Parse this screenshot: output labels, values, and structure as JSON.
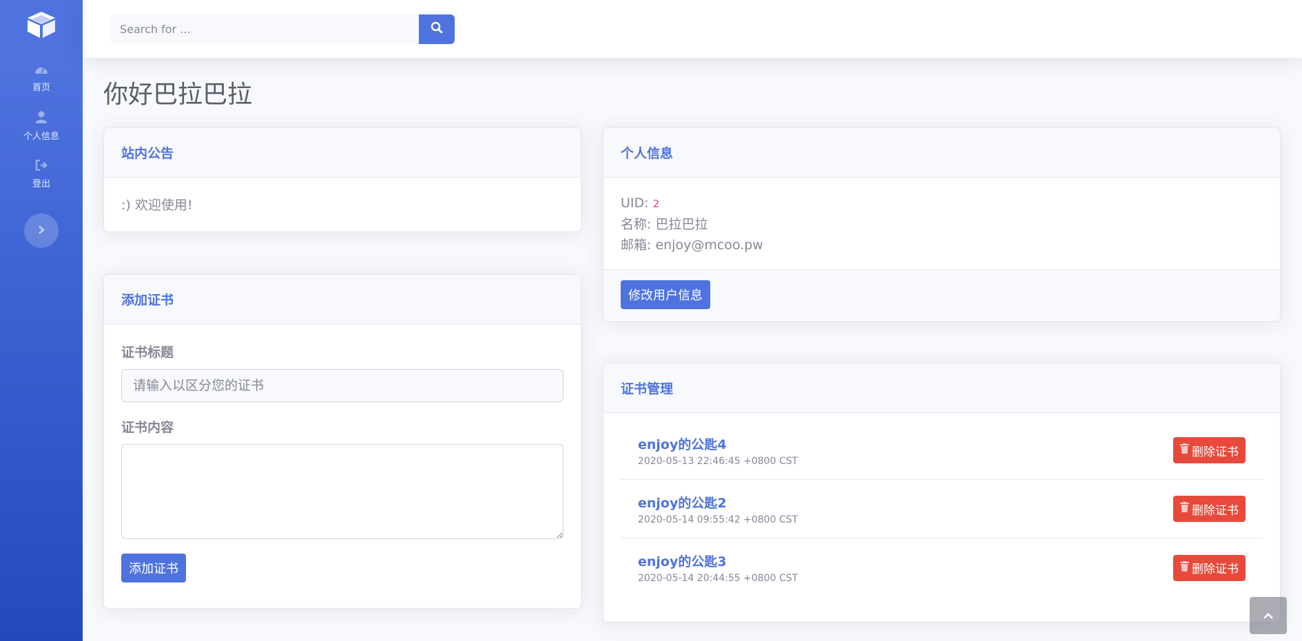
{
  "sidebar": {
    "logo_icon": "cube-icon",
    "items": [
      {
        "label": "首页",
        "icon": "dashboard-icon"
      },
      {
        "label": "个人信息",
        "icon": "user-icon"
      },
      {
        "label": "登出",
        "icon": "sign-out-icon"
      }
    ],
    "toggle_icon": "chevron-right-icon"
  },
  "topbar": {
    "search_placeholder": "Search for ...",
    "search_icon": "search-icon"
  },
  "page": {
    "title": "你好巴拉巴拉"
  },
  "announcement": {
    "title": "站内公告",
    "text": ":) 欢迎使用!"
  },
  "profile": {
    "title": "个人信息",
    "uid_label": "UID:",
    "uid_value": "2",
    "name_label": "名称:",
    "name_value": "巴拉巴拉",
    "email_label": "邮箱:",
    "email_value": "enjoy@mcoo.pw",
    "edit_button": "修改用户信息"
  },
  "add_cert": {
    "title": "添加证书",
    "cert_title_label": "证书标题",
    "cert_title_placeholder": "请输入以区分您的证书",
    "cert_content_label": "证书内容",
    "submit_button": "添加证书"
  },
  "cert_manage": {
    "title": "证书管理",
    "delete_label": "删除证书",
    "items": [
      {
        "name": "enjoy的公匙4",
        "date": "2020-05-13 22:46:45 +0800 CST"
      },
      {
        "name": "enjoy的公匙2",
        "date": "2020-05-14 09:55:42 +0800 CST"
      },
      {
        "name": "enjoy的公匙3",
        "date": "2020-05-14 20:44:55 +0800 CST"
      }
    ]
  },
  "colors": {
    "primary": "#4e73df",
    "danger": "#e74a3b",
    "text": "#858796",
    "uid_accent": "#e83e8c"
  }
}
